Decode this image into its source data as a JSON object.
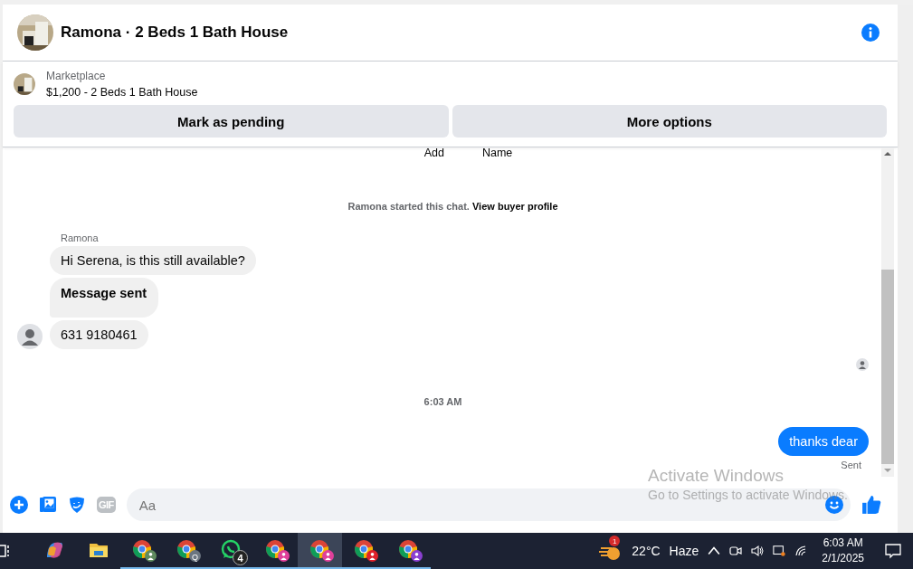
{
  "header": {
    "title": "Ramona · 2 Beds 1 Bath House"
  },
  "listing": {
    "source": "Marketplace",
    "price_title": "$1,200 - 2 Beds 1 Bath House",
    "buttons": [
      "Mark as pending",
      "More options"
    ]
  },
  "top_labels": [
    "Add",
    "Name"
  ],
  "notice": {
    "text": "Ramona started this chat.",
    "link": "View buyer profile"
  },
  "sender": "Ramona",
  "incoming": [
    {
      "text": "Hi Serena, is this still available?",
      "bold": false
    },
    {
      "text": "Message sent",
      "bold": true
    },
    {
      "text": "631 9180461",
      "bold": false
    }
  ],
  "timestamp": "6:03 AM",
  "outgoing": {
    "text": "thanks dear",
    "status": "Sent"
  },
  "composer": {
    "gif_button": "GIF",
    "placeholder": "Aa"
  },
  "os_watermark": [
    "Activate Windows",
    "Go to Settings to activate Windows."
  ],
  "taskbar": {
    "apps": [
      {
        "kind": "copilot",
        "selected": false
      },
      {
        "kind": "folder",
        "selected": false
      },
      {
        "kind": "chrome",
        "color": "#5f8a5f",
        "selected": false
      },
      {
        "kind": "chrome",
        "color": "#6b7580",
        "badge": "Q",
        "selected": false
      },
      {
        "kind": "whatsapp",
        "badge": "4",
        "selected": false
      },
      {
        "kind": "chrome",
        "color": "#e0409a",
        "selected": false
      },
      {
        "kind": "chrome",
        "color": "#e0409a",
        "selected": true
      },
      {
        "kind": "chrome",
        "color": "#e0202a",
        "selected": false
      },
      {
        "kind": "chrome",
        "color": "#8a40d0",
        "selected": false
      }
    ],
    "weather_badge": "1",
    "temperature": "22°C",
    "condition": "Haze",
    "time": "6:03 AM",
    "date": "2/1/2025"
  }
}
